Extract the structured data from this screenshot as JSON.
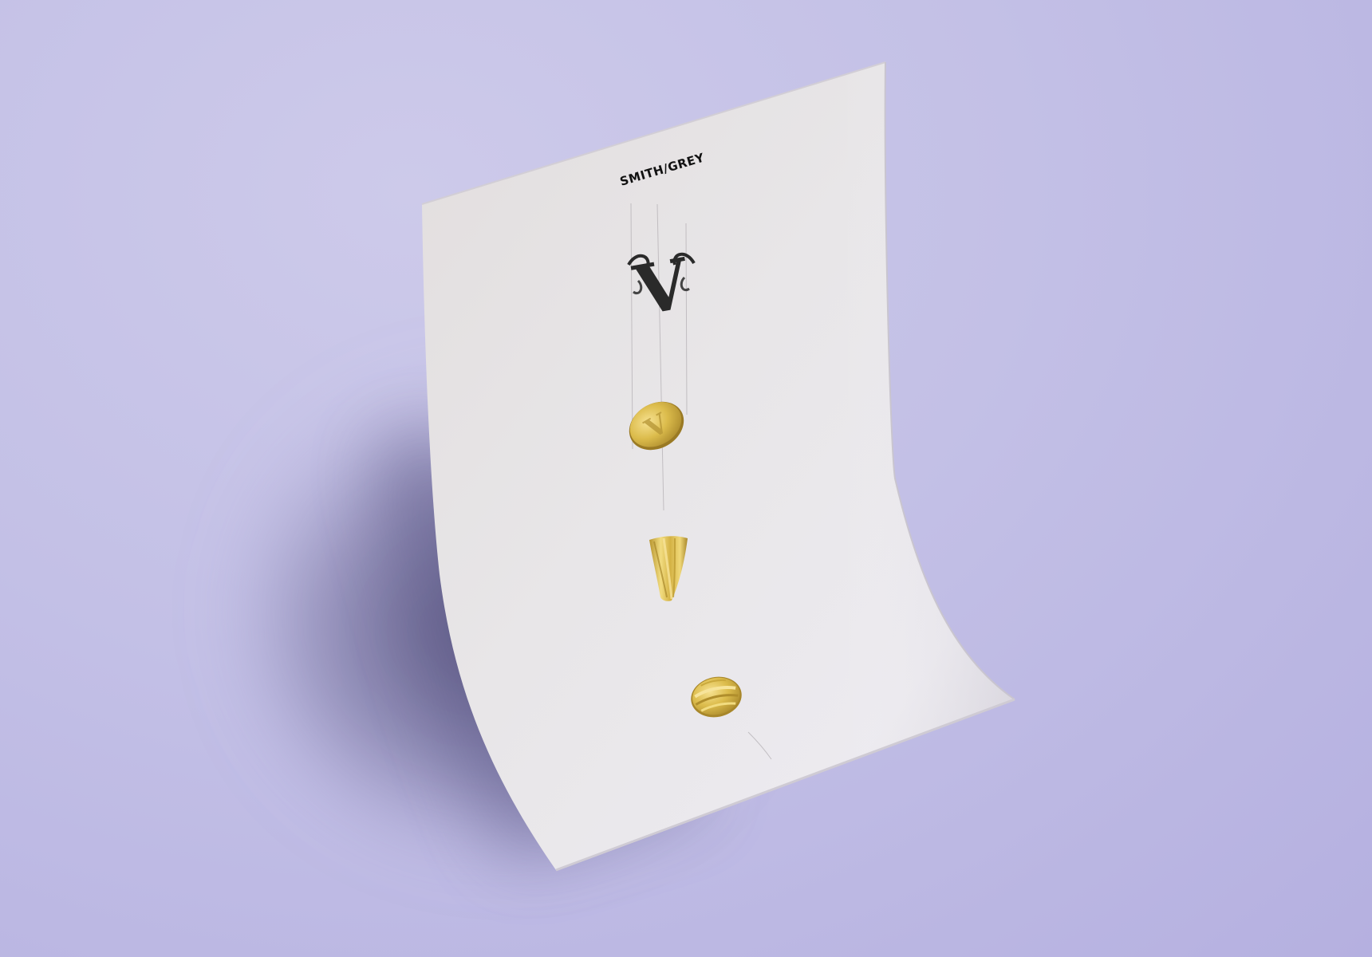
{
  "brand": {
    "name": "SMITH/GREY",
    "monogram_letter": "V"
  },
  "colors": {
    "background": "#c5c2e8",
    "paper": "#e6e3e6",
    "ink": "#111111",
    "gold": "#d8b84a",
    "gold_dark": "#a8872a",
    "gold_light": "#f2dc80"
  },
  "items": [
    {
      "name": "monogram-v",
      "type": "engraved monogram"
    },
    {
      "name": "signet-ring-top",
      "type": "oval signet ring face"
    },
    {
      "name": "signet-ring-side",
      "type": "ring shank side view"
    },
    {
      "name": "signet-ring-bottom",
      "type": "ring band view"
    }
  ]
}
